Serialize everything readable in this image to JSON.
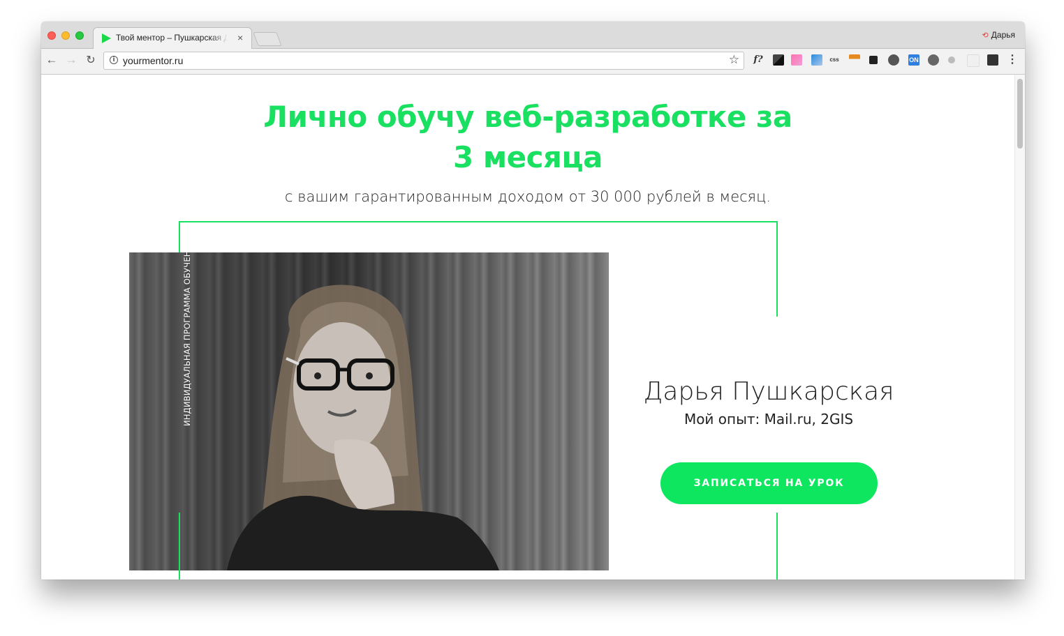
{
  "browser": {
    "tab_title": "Твой ментор – Пушкарская Д",
    "tab_close": "×",
    "profile_name": "Дарья",
    "url": "yourmentor.ru",
    "extensions_text": "f?",
    "ext_css_label": "css",
    "ext_on_label": "ON"
  },
  "hero": {
    "headline_line1": "Лично обучу веб-разработке за",
    "headline_line2": "3 месяца",
    "subtitle": "с вашим гарантированным доходом от 30 000 рублей в месяц."
  },
  "mentor": {
    "vertical_caption": "ИНДИВИДУАЛЬНАЯ ПРОГРАММА ОБУЧЕНИЯ",
    "name": "Дарья Пушкарская",
    "experience": "Мой опыт: Mail.ru, 2GIS",
    "cta_label": "ЗАПИСАТЬСЯ НА УРОК"
  },
  "colors": {
    "accent": "#19e060",
    "button": "#0ee660",
    "text": "#222222"
  }
}
